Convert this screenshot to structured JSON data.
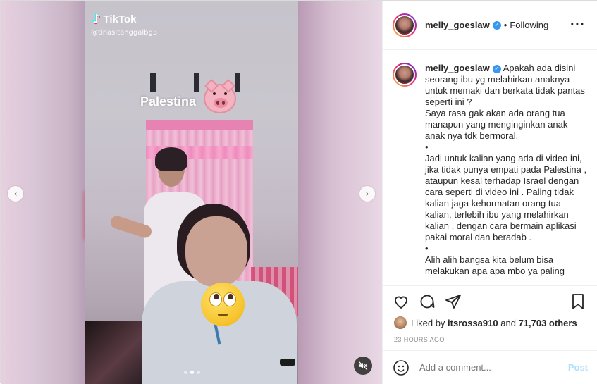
{
  "media": {
    "tiktok_brand": "TikTok",
    "tiktok_handle": "@tinasitanggalbg3",
    "sticker_text": "Palestina",
    "prev_arrow": "‹",
    "next_arrow": "›",
    "slide_count": 3,
    "active_slide": 2,
    "mute_icon": "muted-speaker-icon"
  },
  "post": {
    "username": "melly_goeslaw",
    "verified_mark": "✓",
    "separator": "•",
    "follow_status": "Following",
    "more_label": "···",
    "caption": "Apakah ada disini seorang ibu yg melahirkan anaknya untuk memaki dan berkata tidak pantas seperti ini ?\nSaya rasa gak akan ada orang tua manapun yang menginginkan anak anak nya tdk bermoral.\n•\nJadi untuk kalian yang ada di video ini, jika tidak punya empati pada Palestina , ataupun kesal terhadap Israel dengan cara seperti di video ini . Paling tidak kalian jaga kehormatan orang tua kalian, terlebih ibu yang melahirkan kalian , dengan cara bermain aplikasi pakai moral dan beradab .\n•\nAlih alih bangsa kita belum bisa melakukan apa apa mbo ya paling"
  },
  "engagement": {
    "liked_prefix": "Liked by ",
    "liked_user": "itsrossa910",
    "liked_mid": " and ",
    "liked_count": "71,703 others",
    "timestamp": "23 HOURS AGO"
  },
  "comment_box": {
    "placeholder": "Add a comment...",
    "post_label": "Post"
  },
  "colors": {
    "verified": "#3897f0",
    "post_button": "#b2dffc",
    "muted_text": "#8e8e8e"
  }
}
